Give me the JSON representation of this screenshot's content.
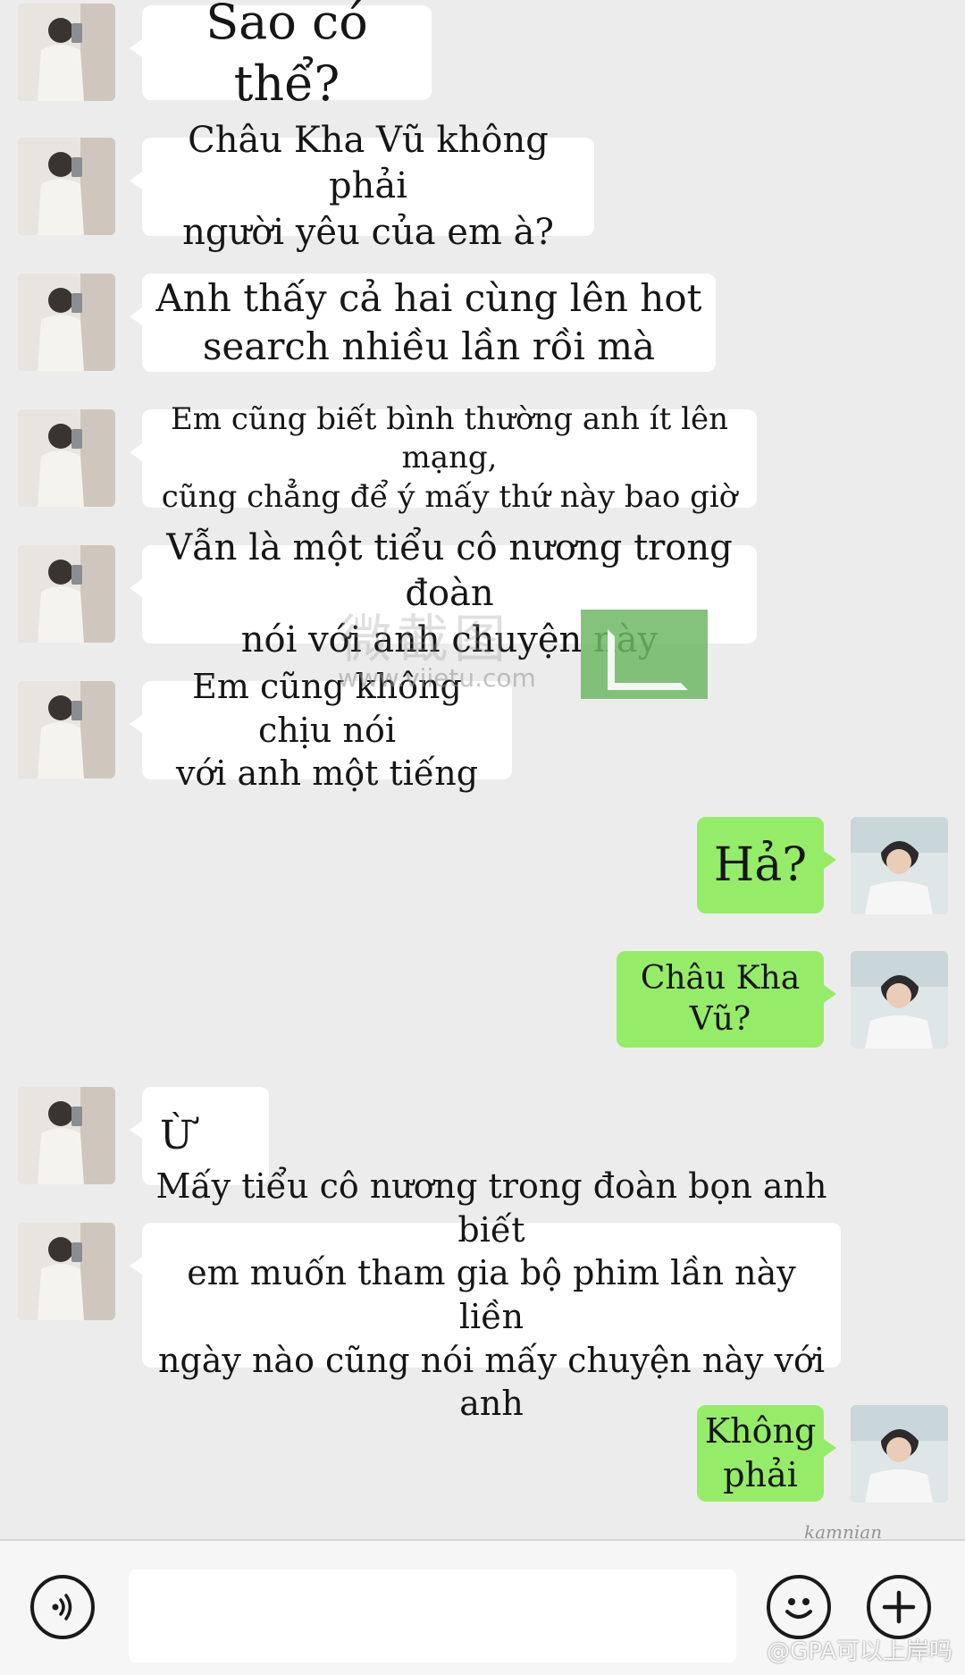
{
  "messages": [
    {
      "side": "left",
      "text": "Sao có thể?"
    },
    {
      "side": "left",
      "text": "Châu Kha Vũ không phải\nngười yêu của em à?"
    },
    {
      "side": "left",
      "text": "Anh thấy cả hai cùng lên hot\nsearch nhiều lần rồi mà"
    },
    {
      "side": "left",
      "text": "Em cũng biết bình thường anh ít lên mạng,\ncũng chẳng để ý mấy thứ này bao giờ"
    },
    {
      "side": "left",
      "text": "Vẫn là một tiểu cô nương trong đoàn\nnói với anh chuyện này"
    },
    {
      "side": "left",
      "text": "Em cũng không chịu nói\nvới anh một tiếng"
    },
    {
      "side": "right",
      "text": "Hả?"
    },
    {
      "side": "right",
      "text": "Châu Kha Vũ?"
    },
    {
      "side": "left",
      "text": "Ừ"
    },
    {
      "side": "left",
      "text": "Mấy tiểu cô nương trong đoàn bọn anh biết\nem muốn tham gia bộ phim lần này liền\nngày nào cũng nói mấy chuyện này với anh"
    },
    {
      "side": "right",
      "text": "Không\nphải"
    }
  ],
  "watermark": {
    "text": "微截图",
    "url": "www.viietu.com"
  },
  "signature": "kamnian",
  "corner_watermark": "@GPA可以上岸吗",
  "input_bar": {
    "voice_icon": "voice-icon",
    "emoji_icon": "emoji-icon",
    "plus_icon": "plus-icon"
  },
  "colors": {
    "background": "#ececec",
    "incoming_bubble": "#ffffff",
    "outgoing_bubble": "#95ec69"
  }
}
